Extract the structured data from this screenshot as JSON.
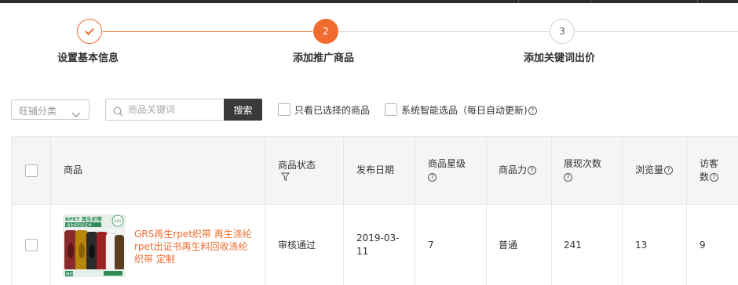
{
  "steps": [
    {
      "number": "1",
      "label": "设置基本信息",
      "state": "done"
    },
    {
      "number": "2",
      "label": "添加推广商品",
      "state": "active"
    },
    {
      "number": "3",
      "label": "添加关键词出价",
      "state": "todo"
    }
  ],
  "colors": {
    "accent": "#f06b2f",
    "dark_button": "#3a3a3a",
    "header_bg": "#f5f5f5"
  },
  "filters": {
    "category_select": "旺铺分类",
    "search_placeholder": "商品关键词",
    "search_button": "搜索",
    "only_selected_label": "只看已选择的商品",
    "smart_select_label": "系统智能选品（每日自动更新)"
  },
  "table": {
    "columns": {
      "product": "商品",
      "status": "商品状态",
      "publish_date": "发布日期",
      "star_level": "商品星级",
      "product_power": "商品力",
      "impressions": "展现次数",
      "views": "浏览量",
      "visitors": "访客数"
    },
    "rows": [
      {
        "image_text": {
          "brand": "RPET 再生织带",
          "sub": "再生纺织品证书",
          "mark": "精织",
          "stamp": "GRS"
        },
        "title": "GRS再生rpet织带 再生涤纶rpet出证书再生料回收涤纶织带 定制",
        "status": "审核通过",
        "publish_date": "2019-03-11",
        "star_level": "7",
        "product_power": "普通",
        "impressions": "241",
        "views": "13",
        "visitors": "9"
      }
    ]
  }
}
